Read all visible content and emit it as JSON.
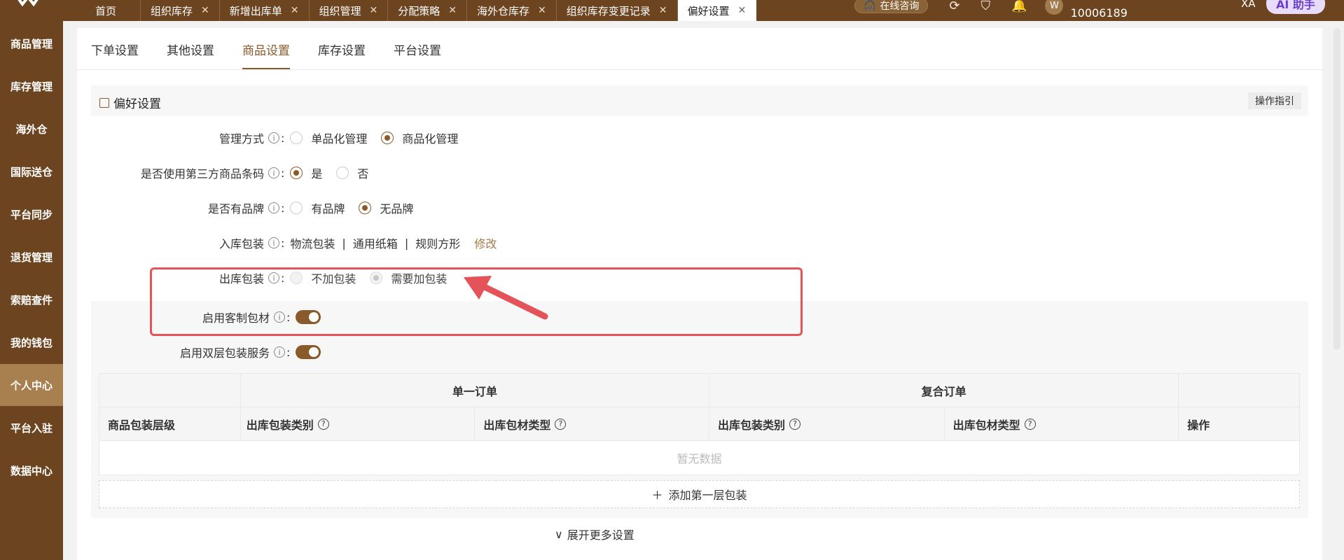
{
  "tabs": [
    {
      "label": "首页",
      "closable": false
    },
    {
      "label": "组织库存",
      "closable": true
    },
    {
      "label": "新增出库单",
      "closable": true
    },
    {
      "label": "组织管理",
      "closable": true
    },
    {
      "label": "分配策略",
      "closable": true
    },
    {
      "label": "海外仓库存",
      "closable": true
    },
    {
      "label": "组织库存变更记录",
      "closable": true
    },
    {
      "label": "偏好设置",
      "closable": true,
      "active": true
    }
  ],
  "topbar": {
    "consult_label": "在线咨询",
    "avatar_letter": "W",
    "user_id": "10006189",
    "lang_label": "XA",
    "ai_label": "AI 助手"
  },
  "sidebar": {
    "items": [
      {
        "label": "商品管理"
      },
      {
        "label": "库存管理"
      },
      {
        "label": "海外仓"
      },
      {
        "label": "国际送仓"
      },
      {
        "label": "平台同步"
      },
      {
        "label": "退货管理"
      },
      {
        "label": "索赔查件"
      },
      {
        "label": "我的钱包"
      },
      {
        "label": "个人中心",
        "active": true
      },
      {
        "label": "平台入驻"
      },
      {
        "label": "数据中心"
      }
    ]
  },
  "subtabs": [
    {
      "label": "下单设置"
    },
    {
      "label": "其他设置"
    },
    {
      "label": "商品设置",
      "active": true
    },
    {
      "label": "库存设置"
    },
    {
      "label": "平台设置"
    }
  ],
  "section": {
    "title": "偏好设置",
    "guide_button": "操作指引"
  },
  "settings": {
    "management": {
      "label": "管理方式",
      "options": [
        "单品化管理",
        "商品化管理"
      ],
      "selected": "商品化管理"
    },
    "barcode": {
      "label": "是否使用第三方商品条码",
      "options": [
        "是",
        "否"
      ],
      "selected": "是"
    },
    "brand": {
      "label": "是否有品牌",
      "options": [
        "有品牌",
        "无品牌"
      ],
      "selected": "无品牌"
    },
    "inbound_pack": {
      "label": "入库包装",
      "values": [
        "物流包装",
        "通用纸箱",
        "规则方形"
      ],
      "edit_label": "修改"
    },
    "outbound_pack": {
      "label": "出库包装",
      "options": [
        "不加包装",
        "需要加包装"
      ],
      "selected": "需要加包装",
      "disabled": true
    },
    "custom_material": {
      "label": "启用客制包材",
      "enabled": true
    },
    "double_layer": {
      "label": "启用双层包装服务",
      "enabled": true
    }
  },
  "table": {
    "group_single": "单一订单",
    "group_compound": "复合订单",
    "columns": [
      "商品包装层级",
      "出库包装类别",
      "出库包材类型",
      "出库包装类别",
      "出库包材类型",
      "操作"
    ],
    "empty_text": "暂无数据",
    "add_label": "添加第一层包装"
  },
  "expand_label": "展开更多设置",
  "colors": {
    "brand": "#6d4420",
    "accent": "#8a5a2b",
    "highlight": "#e4525a"
  }
}
